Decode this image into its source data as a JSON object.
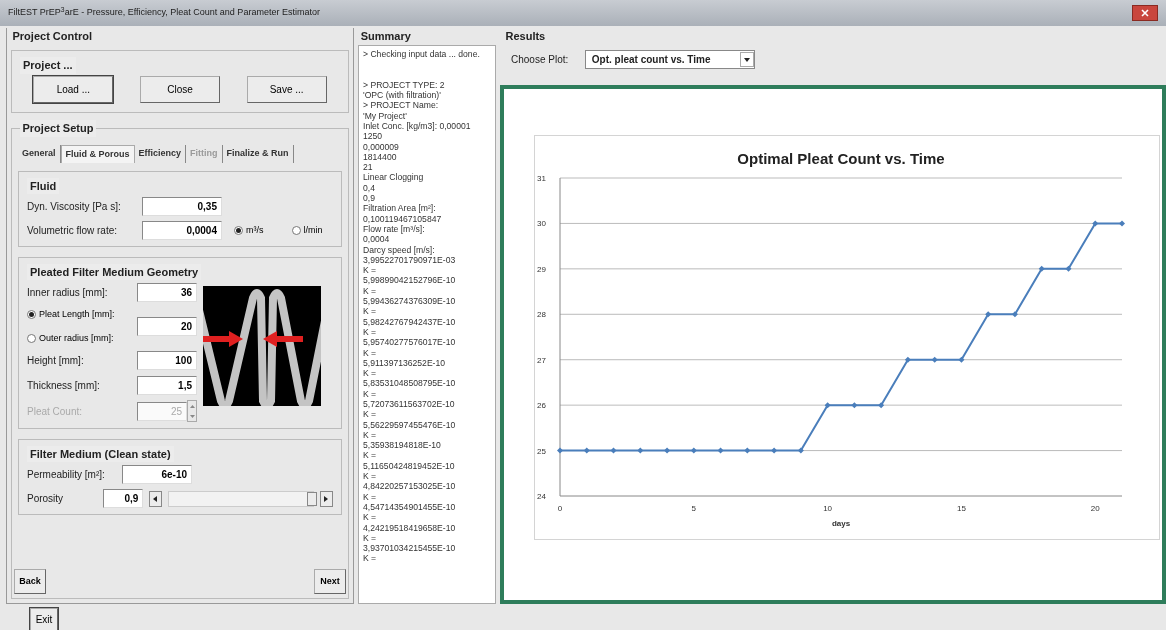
{
  "window": {
    "title": "FiltEST PrEP$^{3}$arE - Pressure, Efficiency, Pleat Count and Parameter Estimator"
  },
  "project_control": {
    "title": "Project Control",
    "group_title": "Project ...",
    "buttons": [
      "Load ...",
      "Close",
      "Save ..."
    ]
  },
  "project_setup": {
    "title": "Project Setup",
    "tabs": [
      {
        "label": "General",
        "selected": false,
        "disabled": false
      },
      {
        "label": "Fluid & Porous",
        "selected": true,
        "disabled": false
      },
      {
        "label": "Efficiency",
        "selected": false,
        "disabled": false
      },
      {
        "label": "Fitting",
        "selected": false,
        "disabled": true
      },
      {
        "label": "Finalize & Run",
        "selected": false,
        "disabled": false
      }
    ],
    "fluid": {
      "title": "Fluid",
      "viscosity": {
        "label": "Dyn. Viscosity [Pa s]:",
        "value": "0,35"
      },
      "flow": {
        "label": "Volumetric flow rate:",
        "value": "0,0004"
      },
      "units": [
        {
          "label": "m³/s",
          "selected": true
        },
        {
          "label": "l/min",
          "selected": false
        }
      ]
    },
    "geometry": {
      "title": "Pleated Filter Medium Geometry",
      "inner_radius": {
        "label": "Inner radius [mm]:",
        "value": "36"
      },
      "options": [
        {
          "label": "Pleat Length [mm]:",
          "selected": true
        },
        {
          "label": "Outer radius [mm]:",
          "selected": false
        }
      ],
      "option_value": "20",
      "height": {
        "label": "Height [mm]:",
        "value": "100"
      },
      "thickness": {
        "label": "Thickness [mm]:",
        "value": "1,5"
      },
      "pleat_count": {
        "label": "Pleat Count:",
        "value": "25",
        "disabled": true
      }
    },
    "medium": {
      "title": "Filter Medium (Clean state)",
      "permeability": {
        "label": "Permeability [m²]:",
        "value": "6e-10"
      },
      "porosity": {
        "label": "Porosity",
        "value": "0,9",
        "level": 0.97
      }
    },
    "nav": [
      "Back",
      "Next"
    ]
  },
  "summary": {
    "title": "Summary",
    "lines": [
      "> Checking input data ... done.",
      "> PROJECT TYPE: 2",
      "'OPC (with filtration)'",
      "> PROJECT Name:",
      "'My Project'",
      "Inlet Conc. [kg/m3]: 0,00001",
      "1250",
      "0,000009",
      "1814400",
      "21",
      "Linear Clogging",
      "0,4",
      "0,9",
      "Filtration Area [m²]:",
      "0,100119467105847",
      "Flow rate [m³/s]:",
      "0,0004",
      "Darcy speed [m/s]:",
      "3,99522701790971E-03",
      "K =",
      "5,99899042152796E-10",
      "K =",
      "5,99436274376309E-10",
      "K =",
      "5,98242767942437E-10",
      "K =",
      "5,95740277576017E-10",
      "K =",
      "5,911397136252E-10",
      "K =",
      "5,83531048508795E-10",
      "K =",
      "5,72073611563702E-10",
      "K =",
      "5,56229597455476E-10",
      "K =",
      "5,35938194818E-10",
      "K =",
      "5,11650424819452E-10",
      "K =",
      "4,84220257153025E-10",
      "K =",
      "4,54714354901455E-10",
      "K =",
      "4,24219518419658E-10",
      "K =",
      "3,93701034215455E-10",
      "K ="
    ]
  },
  "results": {
    "title": "Results",
    "choose_label": "Choose Plot:",
    "plot_select": "Opt. pleat count vs. Time",
    "chart_data": {
      "type": "line",
      "title": "Optimal Pleat Count vs. Time",
      "xlabel": "days",
      "x": [
        0,
        1,
        2,
        3,
        4,
        5,
        6,
        7,
        8,
        9,
        10,
        11,
        12,
        13,
        14,
        15,
        16,
        17,
        18,
        19,
        20,
        21
      ],
      "grid": true,
      "series": [
        {
          "color": "#4a7ebb",
          "marker": "diamond",
          "values": [
            25,
            25,
            25,
            25,
            25,
            25,
            25,
            25,
            25,
            25,
            26,
            26,
            26,
            27,
            27,
            27,
            28,
            28,
            29,
            29,
            30,
            30
          ]
        }
      ],
      "xlim": [
        0,
        21
      ],
      "ylim": [
        24,
        31
      ],
      "xticks": [
        0,
        5,
        10,
        15,
        20
      ],
      "yticks": [
        24,
        25,
        26,
        27,
        28,
        29,
        30,
        31
      ]
    }
  },
  "exit_button": "Exit"
}
